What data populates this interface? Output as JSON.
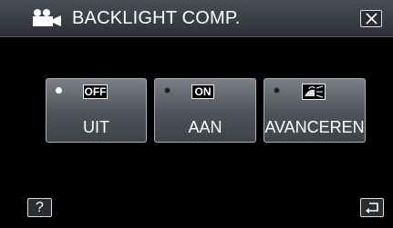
{
  "header": {
    "title": "BACKLIGHT COMP.",
    "mode_icon": "movie-camera-icon",
    "close_icon": "close-icon"
  },
  "options": [
    {
      "badge": "OFF",
      "label": "UIT",
      "selected": true
    },
    {
      "badge": "ON",
      "label": "AAN",
      "selected": false
    },
    {
      "badge_icon": "backlight-advanced-icon",
      "label": "AVANCEREN",
      "selected": false
    }
  ],
  "footer": {
    "help_label": "?",
    "back_icon": "return-arrow-icon"
  }
}
